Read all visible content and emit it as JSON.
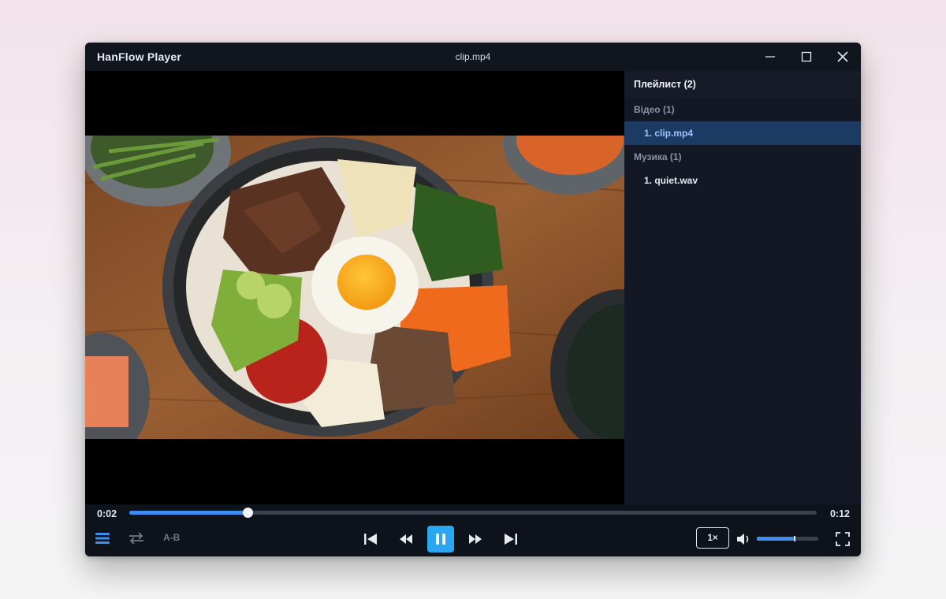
{
  "window": {
    "app_title": "HanFlow Player",
    "file_title": "clip.mp4"
  },
  "titlebar_icons": [
    "minimize-icon",
    "maximize-icon",
    "close-icon"
  ],
  "playlist": {
    "header": "Плейлист (2)",
    "groups": [
      {
        "label": "Відео (1)",
        "items": [
          {
            "label": "1. clip.mp4",
            "active": true
          }
        ]
      },
      {
        "label": "Музика (1)",
        "items": [
          {
            "label": "1. quiet.wav",
            "active": false
          }
        ]
      }
    ]
  },
  "player": {
    "current_time": "0:02",
    "total_time": "0:12",
    "progress_fraction": 0.172,
    "volume_fraction": 0.6,
    "ab_label": "A-B",
    "speed_label": "1×",
    "state": "playing"
  },
  "control_icons": [
    "menu-icon",
    "repeat-icon",
    "skip-previous-icon",
    "rewind-icon",
    "pause-icon",
    "fast-forward-icon",
    "skip-next-icon",
    "volume-icon",
    "fullscreen-icon"
  ],
  "colors": {
    "accent": "#3d8ef0",
    "play_button": "#2aa7f0",
    "active_item_bg": "#1d3a63",
    "window_bg": "#0f131b"
  }
}
